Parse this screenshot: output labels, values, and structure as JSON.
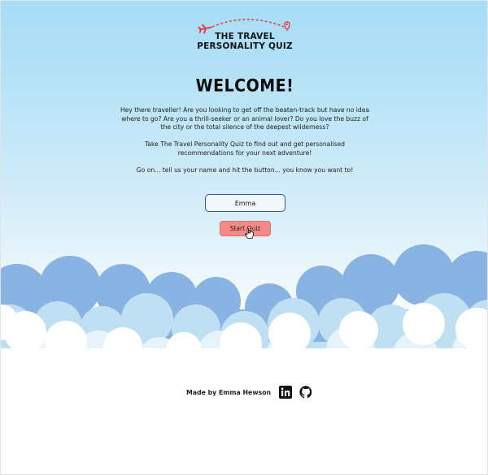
{
  "logo": {
    "line1": "THE TRAVEL",
    "line2": "PERSONALITY QUIZ",
    "icons": [
      "airplane-icon",
      "location-pin-icon"
    ],
    "accent_color": "#e2413a"
  },
  "main": {
    "heading": "WELCOME!",
    "intro_paragraphs": [
      "Hey there traveller! Are you looking to get off the beaten-track but have no idea where to go? Are you a thrill-seeker or an animal lover? Do you love the buzz of the city or the total silence of the deepest wilderness?",
      "Take The Travel Personality Quiz to find out and get personalised recommendations for your next adventure!",
      "Go on... tell us your name and hit the button... you know you want to!"
    ]
  },
  "form": {
    "name_value": "Emma",
    "start_label": "Start Quiz",
    "button_color": "#f58a86",
    "input_border_color": "#2f5aa0"
  },
  "footer": {
    "made_by": "Made by Emma Hewson",
    "icons": [
      "linkedin-icon",
      "github-icon"
    ]
  },
  "colors": {
    "sky_top": "#a6dcf6",
    "cloud_dark": "#89b3e2",
    "cloud_mid": "#bfdff3",
    "cloud_light": "#ffffff"
  }
}
